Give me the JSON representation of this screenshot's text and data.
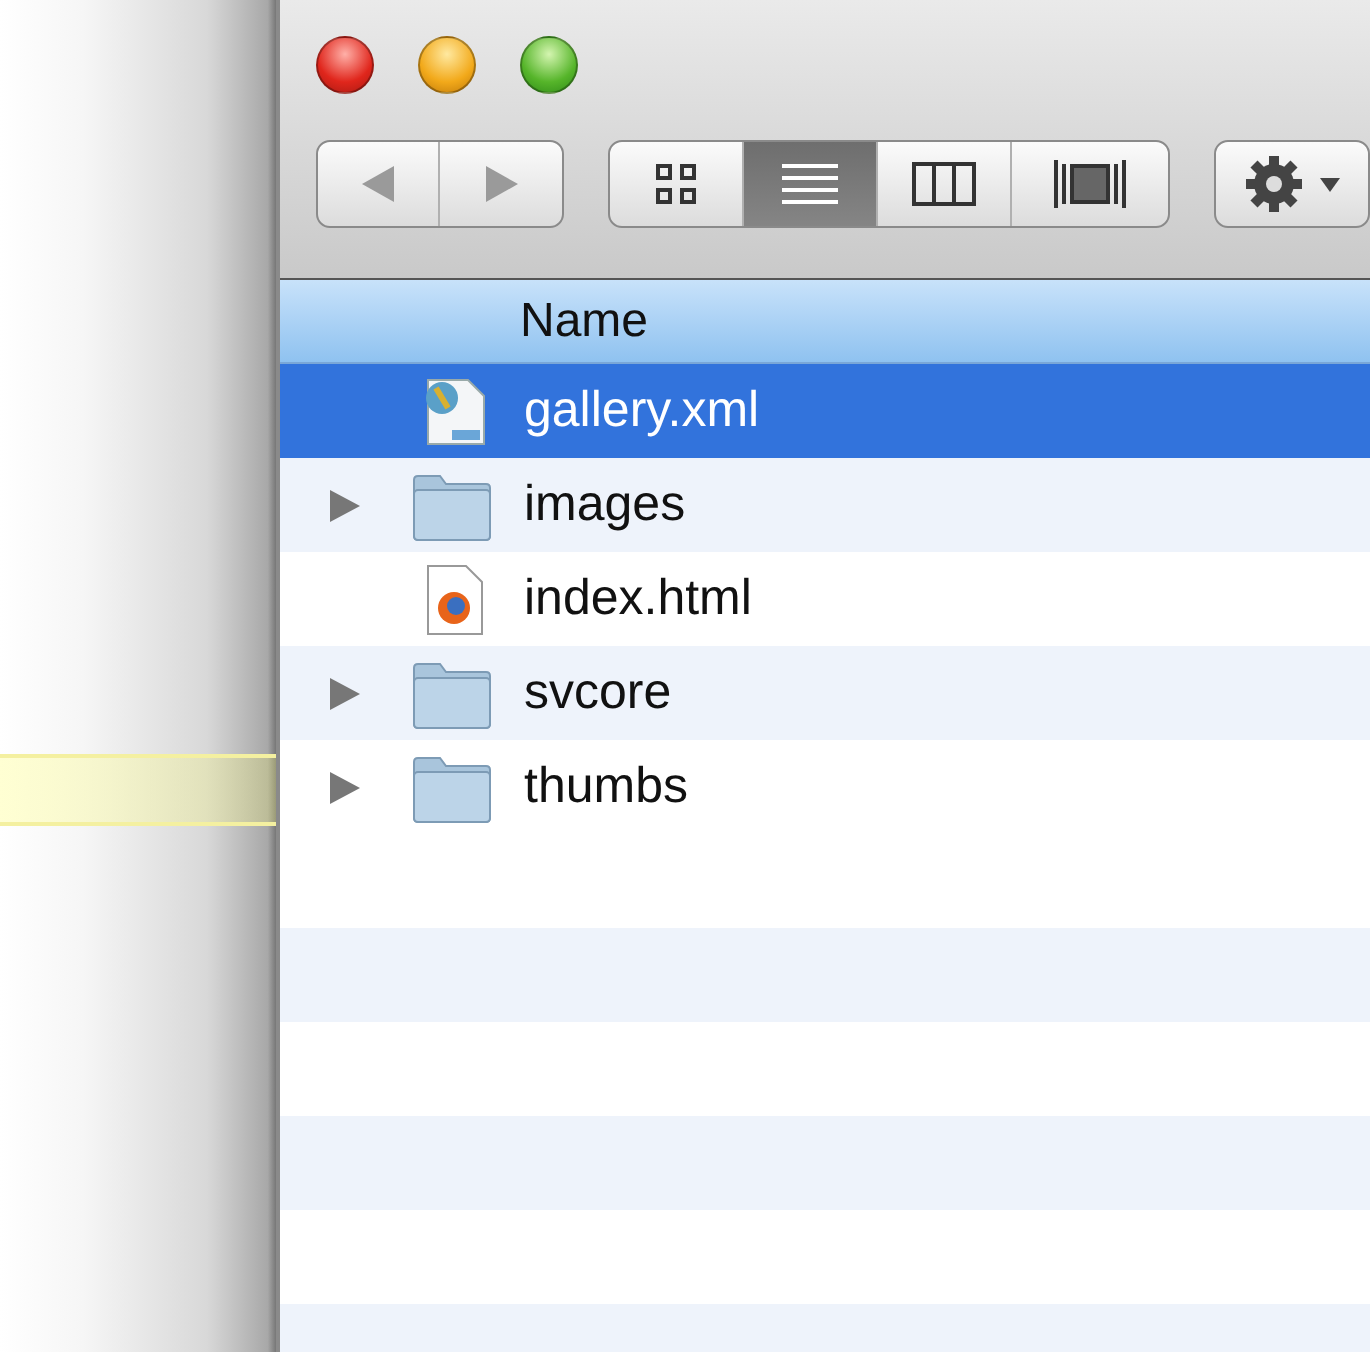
{
  "toolbar": {
    "view_buttons": [
      {
        "kind": "icons",
        "selected": false
      },
      {
        "kind": "list",
        "selected": true
      },
      {
        "kind": "columns",
        "selected": false
      },
      {
        "kind": "coverflow",
        "selected": false
      }
    ]
  },
  "list": {
    "column": "Name",
    "rows": [
      {
        "name": "gallery.xml",
        "kind": "xml",
        "selected": true
      },
      {
        "name": "images",
        "kind": "folder",
        "selected": false
      },
      {
        "name": "index.html",
        "kind": "html",
        "selected": false
      },
      {
        "name": "svcore",
        "kind": "folder",
        "selected": false
      },
      {
        "name": "thumbs",
        "kind": "folder",
        "selected": false
      }
    ]
  }
}
